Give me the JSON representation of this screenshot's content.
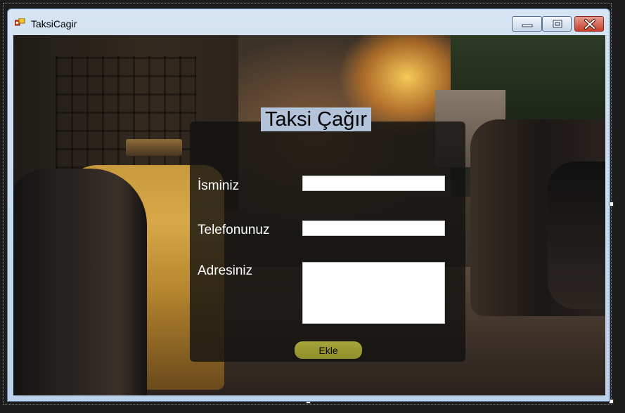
{
  "window": {
    "title": "TaksiCagir",
    "icon": "form-icon",
    "controls": {
      "minimize": "minimize-icon",
      "maximize": "maximize-icon",
      "close": "close-icon"
    }
  },
  "form": {
    "heading": "Taksi Çağır",
    "fields": {
      "name": {
        "label": "İsminiz",
        "value": ""
      },
      "phone": {
        "label": "Telefonunuz",
        "value": ""
      },
      "address": {
        "label": "Adresiniz",
        "value": ""
      }
    },
    "submit_label": "Ekle"
  },
  "colors": {
    "title_bar": "#c9d9ec",
    "heading_bg": "#b3c4da",
    "panel_bg": "#121210",
    "button_bg": "#9c9b30",
    "label_text": "#ffffff",
    "close_button": "#c94a36"
  }
}
